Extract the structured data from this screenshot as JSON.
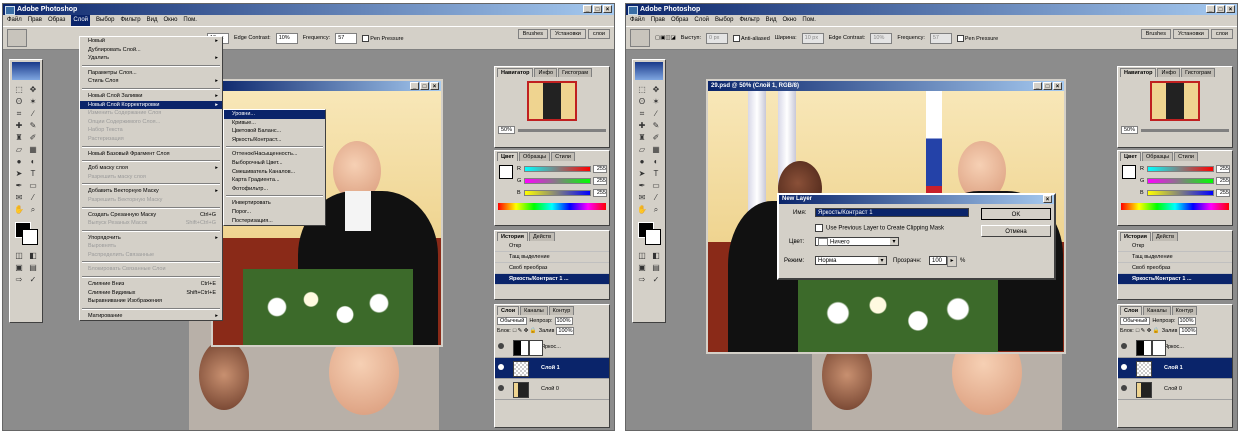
{
  "app_title": "Adobe Photoshop",
  "menubar": [
    "Файл",
    "Прав",
    "Образ",
    "Слой",
    "Выбор",
    "Фильтр",
    "Вид",
    "Окно",
    "Пом."
  ],
  "left": {
    "optbar": {
      "width_value": "10 px",
      "edge_label": "Edge Contrast:",
      "edge_value": "10%",
      "frequency_label": "Frequency:",
      "frequency_value": "57",
      "pen_pressure": "Pen Pressure"
    },
    "layer_menu": {
      "items": [
        {
          "label": "Новый",
          "arrow": true
        },
        {
          "label": "Дублировать Слой..."
        },
        {
          "label": "Удалить",
          "arrow": true
        },
        {
          "sep": true
        },
        {
          "label": "Параметры Слоя..."
        },
        {
          "label": "Стиль Слоя",
          "arrow": true
        },
        {
          "sep": true
        },
        {
          "label": "Новый Слой Заливки",
          "arrow": true
        },
        {
          "label": "Новый Слой Корректировки",
          "arrow": true,
          "hl": true
        },
        {
          "label": "Изменить Содержание Слоя",
          "dis": true
        },
        {
          "label": "Опции Содержимого Слоя...",
          "dis": true
        },
        {
          "label": "Набор Текста",
          "dis": true
        },
        {
          "label": "Растеризация",
          "dis": true
        },
        {
          "sep": true
        },
        {
          "label": "Новый Базовый Фрагмент Слоя"
        },
        {
          "sep": true
        },
        {
          "label": "Доб маску слоя",
          "arrow": true
        },
        {
          "label": "Разрешить маску слоя",
          "dis": true
        },
        {
          "sep": true
        },
        {
          "label": "Добавить Векторную Маску",
          "arrow": true
        },
        {
          "label": "Разрешить Векторную Маску",
          "dis": true
        },
        {
          "sep": true
        },
        {
          "label": "Создать Срезанную Маску",
          "shortcut": "Ctrl+G"
        },
        {
          "label": "Выпуск Резаных Масок",
          "shortcut": "Shift+Ctrl+G",
          "dis": true
        },
        {
          "sep": true
        },
        {
          "label": "Упорядочить",
          "arrow": true
        },
        {
          "label": "Выровнять",
          "dis": true
        },
        {
          "label": "Распределить Связанные",
          "dis": true
        },
        {
          "sep": true
        },
        {
          "label": "Блокировать Связанные Слои",
          "dis": true
        },
        {
          "sep": true
        },
        {
          "label": "Слияние Вниз",
          "shortcut": "Ctrl+E"
        },
        {
          "label": "Слияние Видимых",
          "shortcut": "Shift+Ctrl+E"
        },
        {
          "label": "Выравнивание Изображения"
        },
        {
          "sep": true
        },
        {
          "label": "Матирование",
          "arrow": true
        }
      ]
    },
    "adjust_submenu": {
      "items": [
        {
          "label": "Уровни...",
          "hl": true
        },
        {
          "label": "Кривые..."
        },
        {
          "label": "Цветовой Баланс..."
        },
        {
          "label": "Яркость/Контраст..."
        },
        {
          "sep": true
        },
        {
          "label": "Оттенок/Насыщенность..."
        },
        {
          "label": "Выборочный Цвет..."
        },
        {
          "label": "Смешиватель Каналов..."
        },
        {
          "label": "Карта Градиента..."
        },
        {
          "label": "Фотофильтр..."
        },
        {
          "sep": true
        },
        {
          "label": "Инвертировать"
        },
        {
          "label": "Порог..."
        },
        {
          "label": "Постеризация..."
        }
      ]
    }
  },
  "right": {
    "optbar": {
      "feather_label": "Выступ:",
      "feather_value": "0 px",
      "antialias": "Anti-aliased",
      "width_label": "Ширина:",
      "width_value": "10 px",
      "edge_label": "Edge Contrast:",
      "edge_value": "10%",
      "frequency_label": "Frequency:",
      "frequency_value": "57",
      "pen_pressure": "Pen Pressure"
    },
    "doc_title": "29.psd @ 50% (Слой 1, RGB/8)",
    "dialog": {
      "title": "New Layer",
      "name_label": "Имя:",
      "name_value": "Яркость/Контраст 1",
      "clipping_label": "Use Previous Layer to Create Clipping Mask",
      "color_label": "Цвет:",
      "color_value": "Ничего",
      "mode_label": "Режим:",
      "mode_value": "Норма",
      "opacity_label": "Прозрачн:",
      "opacity_value": "100",
      "opacity_unit": "%",
      "ok": "OK",
      "cancel": "Отмена"
    }
  },
  "panels": {
    "palette_tabs": [
      "Brushes",
      "Установки",
      "слои"
    ],
    "navigator_tabs": [
      "Навигатор",
      "Инфо",
      "Гистограм"
    ],
    "zoom_value": "50%",
    "color_tabs": [
      "Цвет",
      "Образцы",
      "Стили"
    ],
    "color_channels": [
      {
        "name": "R",
        "value": "255",
        "color": "#e03030"
      },
      {
        "name": "G",
        "value": "255",
        "color": "#40c040"
      },
      {
        "name": "B",
        "value": "255",
        "color": "#3050e0"
      }
    ],
    "history_tabs": [
      "История",
      "Действ"
    ],
    "history_items": [
      "Откр",
      "Тащ выделение",
      "Своб преобраз",
      "Яркость/Контраст 1 ..."
    ],
    "layers_tabs": [
      "Слои",
      "Каналы",
      "Контур"
    ],
    "blend_mode": "Обычный",
    "opacity_label": "Непрозр:",
    "opacity_value": "100%",
    "lock_label": "Блок:",
    "fill_label": "Залив",
    "fill_value": "100%",
    "layers": [
      {
        "name": "Яркос...",
        "type": "adjust"
      },
      {
        "name": "Слой 1",
        "type": "pixel",
        "sel": true
      },
      {
        "name": "Слой 0",
        "type": "photo"
      }
    ]
  }
}
